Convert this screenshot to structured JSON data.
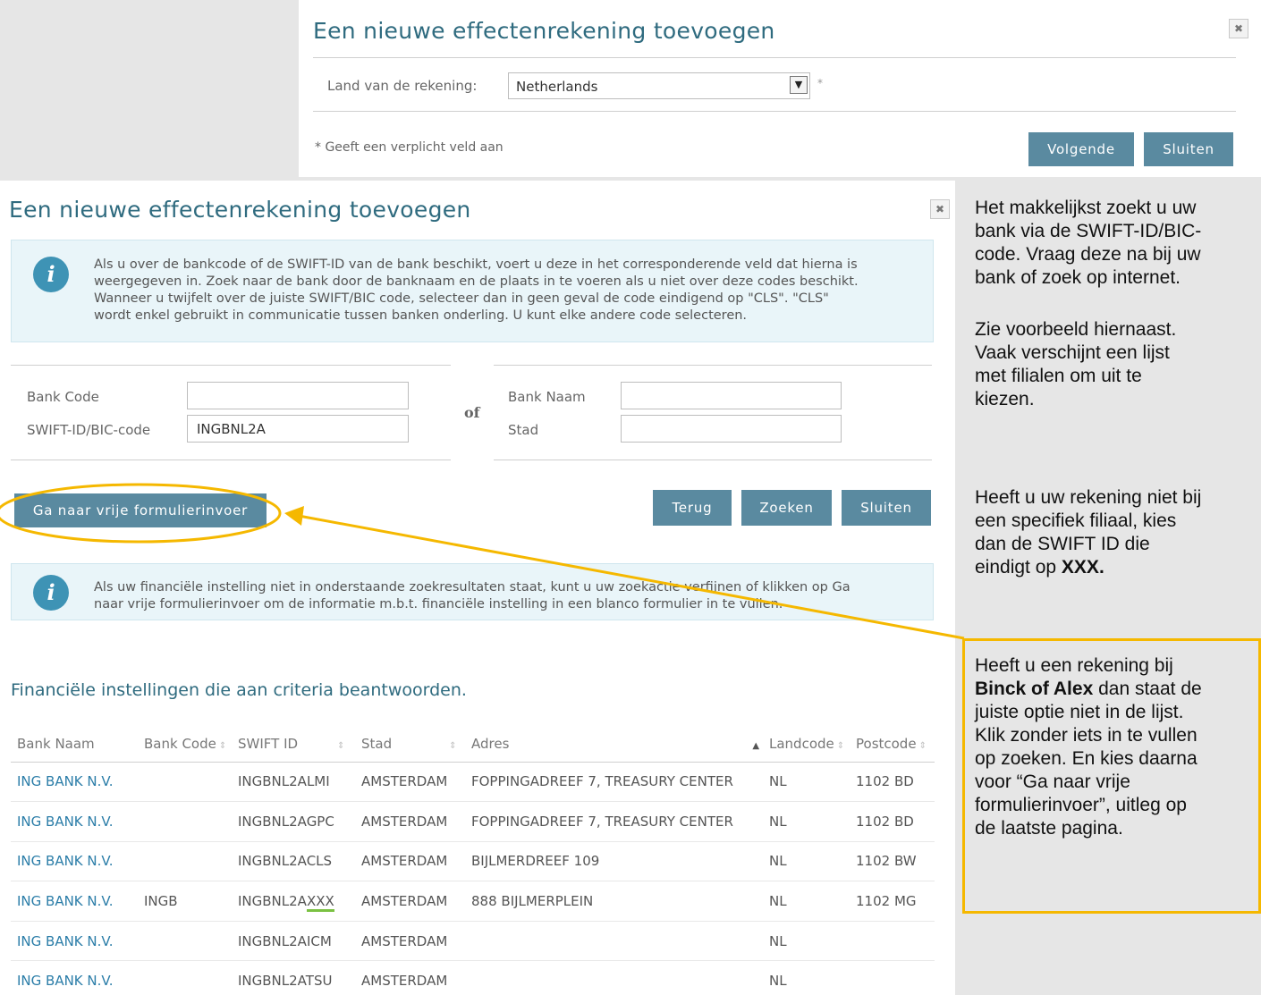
{
  "dialog_top": {
    "title": "Een nieuwe effectenrekening toevoegen",
    "country_label": "Land van de rekening:",
    "country_value": "Netherlands",
    "required_star": "*",
    "required_note": "* Geeft een verplicht veld aan",
    "next_button": "Volgende",
    "close_button": "Sluiten"
  },
  "dialog_main": {
    "title": "Een nieuwe effectenrekening toevoegen",
    "info1": "Als u over de bankcode of de SWIFT-ID van de bank beschikt, voert u deze in het corresponderende veld dat hierna is\nweergegeven in. Zoek naar de bank door de banknaam en de plaats in te voeren als u niet over deze codes beschikt.\nWanneer u twijfelt over de juiste SWIFT/BIC code, selecteer dan in geen geval de code eindigend op \"CLS\". \"CLS\"\nwordt enkel gebruikt in communicatie tussen banken onderling. U kunt elke andere code selecteren.",
    "fields": {
      "bank_code_label": "Bank Code",
      "bank_code_value": "",
      "swift_label": "SWIFT-ID/BIC-code",
      "swift_value": "INGBNL2A",
      "or_label": "of",
      "bank_name_label": "Bank Naam",
      "bank_name_value": "",
      "city_label": "Stad",
      "city_value": ""
    },
    "free_form_button": "Ga naar vrije formulierinvoer",
    "back_button": "Terug",
    "search_button": "Zoeken",
    "close_button": "Sluiten",
    "info2": "Als uw financiële instelling niet in onderstaande zoekresultaten staat, kunt u uw zoekactie verfijnen of klikken op Ga\nnaar vrije formulierinvoer om de informatie m.b.t. financiële instelling in een blanco formulier in te vullen.",
    "results_title": "Financiële instellingen die aan criteria beantwoorden.",
    "columns": [
      "Bank Naam",
      "Bank Code",
      "SWIFT ID",
      "Stad",
      "Adres",
      "Landcode",
      "Postcode"
    ],
    "rows": [
      {
        "name": "ING BANK N.V.",
        "code": "",
        "swift_base": "INGBNL2A",
        "swift_suffix": "LMI",
        "city": "AMSTERDAM",
        "address": "FOPPINGADREEF 7, TREASURY CENTER",
        "country": "NL",
        "postcode": "1102 BD"
      },
      {
        "name": "ING BANK N.V.",
        "code": "",
        "swift_base": "INGBNL2A",
        "swift_suffix": "GPC",
        "city": "AMSTERDAM",
        "address": "FOPPINGADREEF 7, TREASURY CENTER",
        "country": "NL",
        "postcode": "1102 BD"
      },
      {
        "name": "ING BANK N.V.",
        "code": "",
        "swift_base": "INGBNL2A",
        "swift_suffix": "CLS",
        "city": "AMSTERDAM",
        "address": "BIJLMERDREEF 109",
        "country": "NL",
        "postcode": "1102 BW"
      },
      {
        "name": "ING BANK N.V.",
        "code": "INGB",
        "swift_base": "INGBNL2A",
        "swift_suffix": "XXX",
        "city": "AMSTERDAM",
        "address": "888 BIJLMERPLEIN",
        "country": "NL",
        "postcode": "1102 MG"
      },
      {
        "name": "ING BANK N.V.",
        "code": "",
        "swift_base": "INGBNL2A",
        "swift_suffix": "ICM",
        "city": "AMSTERDAM",
        "address": "",
        "country": "NL",
        "postcode": ""
      },
      {
        "name": "ING BANK N.V.",
        "code": "",
        "swift_base": "INGBNL2A",
        "swift_suffix": "TSU",
        "city": "AMSTERDAM",
        "address": "",
        "country": "NL",
        "postcode": ""
      }
    ]
  },
  "annotations": {
    "p1": "Het makkelijkst zoekt u uw\nbank via de SWIFT-ID/BIC-\ncode. Vraag deze na bij uw\nbank of zoek op internet.",
    "p2": "Zie voorbeeld hiernaast.\nVaak verschijnt een lijst\nmet filialen om uit te\nkiezen.",
    "p3_pre": "Heeft u uw rekening niet bij\neen specifiek filiaal, kies\ndan de SWIFT ID die\neindigt op ",
    "p3_bold": "XXX.",
    "p4_pre": "Heeft u een rekening bij\n",
    "p4_bold": "Binck of Alex",
    "p4_post": " dan staat de\njuiste optie niet in de lijst.\nKlik zonder iets in te vullen\nop zoeken. En kies daarna\nvoor “Ga naar vrije\nformulierinvoer”, uitleg op\nde laatste pagina.",
    "highlight_color": "#f5b800"
  }
}
